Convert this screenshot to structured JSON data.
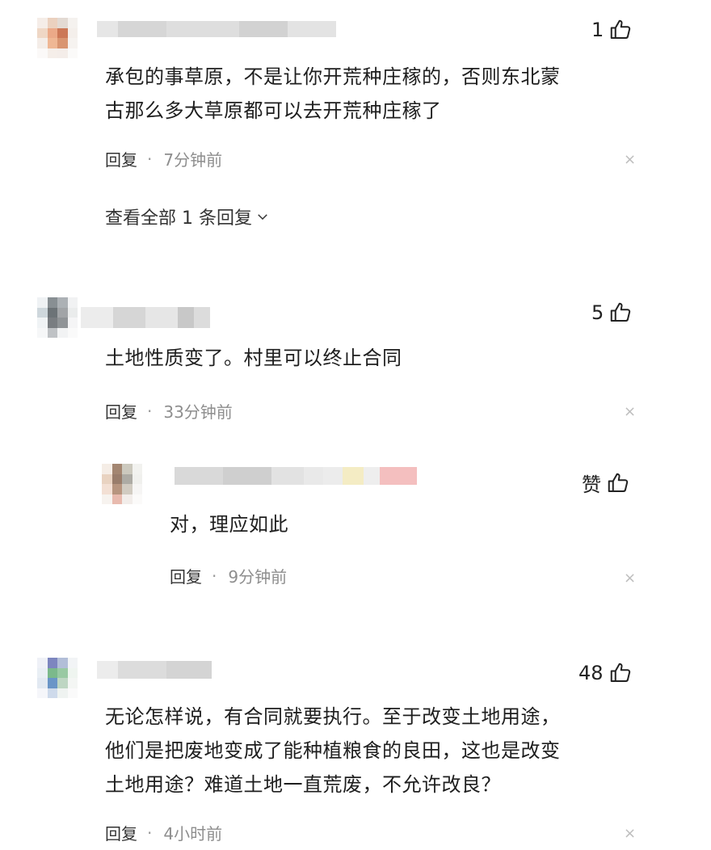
{
  "comments": [
    {
      "likes": "1",
      "text_lines": [
        "承包的事草原，不是让你开荒种庄稼的，否则东北蒙",
        "古那么多大草原都可以去开荒种庄稼了"
      ],
      "reply_label": "回复",
      "separator": "·",
      "time": "7分钟前",
      "view_replies": "查看全部 1 条回复"
    },
    {
      "likes": "5",
      "text_lines": [
        "土地性质变了。村里可以终止合同"
      ],
      "reply_label": "回复",
      "separator": "·",
      "time": "33分钟前",
      "sub_reply": {
        "likes": "赞",
        "text_lines": [
          "对，理应如此"
        ],
        "reply_label": "回复",
        "separator": "·",
        "time": "9分钟前"
      }
    },
    {
      "likes": "48",
      "text_lines": [
        "无论怎样说，有合同就要执行。至于改变土地用途，",
        "他们是把废地变成了能种植粮食的良田，这也是改变",
        "土地用途？难道土地一直荒废，不允许改良？"
      ],
      "reply_label": "回复",
      "separator": "·",
      "time": "4小时前"
    }
  ],
  "icons": {
    "like": "thumbs-up-icon",
    "close": "close-icon",
    "expand": "chevron-down-icon"
  },
  "colors": {
    "text": "#1e1e1e",
    "meta": "#8e8e8e",
    "close": "#bdbdbd"
  }
}
